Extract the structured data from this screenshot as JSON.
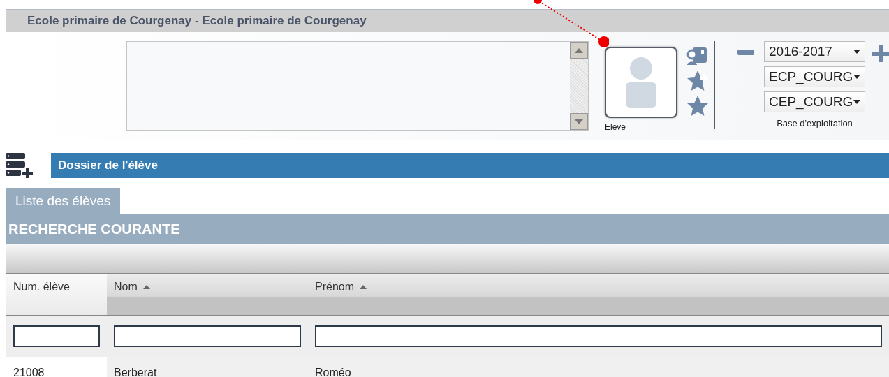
{
  "header": {
    "title": "Ecole primaire de Courgenay - Ecole primaire de Courgenay",
    "photo_label": "Elève",
    "selects": [
      {
        "value": "2016-2017"
      },
      {
        "value": "ECP_COURG"
      },
      {
        "value": "CEP_COURG"
      }
    ],
    "base_label": "Base d'exploitation"
  },
  "section": {
    "title": "Dossier de l'élève"
  },
  "tabs": [
    {
      "label": "Liste des élèves",
      "selected": true
    }
  ],
  "panel_title": "RECHERCHE COURANTE",
  "table": {
    "columns": [
      {
        "label": "Num. élève",
        "sorted": false
      },
      {
        "label": "Nom",
        "sorted": true
      },
      {
        "label": "Prénom",
        "sorted": true
      }
    ],
    "rows": [
      [
        "21008",
        "Berberat",
        "Roméo"
      ]
    ]
  }
}
